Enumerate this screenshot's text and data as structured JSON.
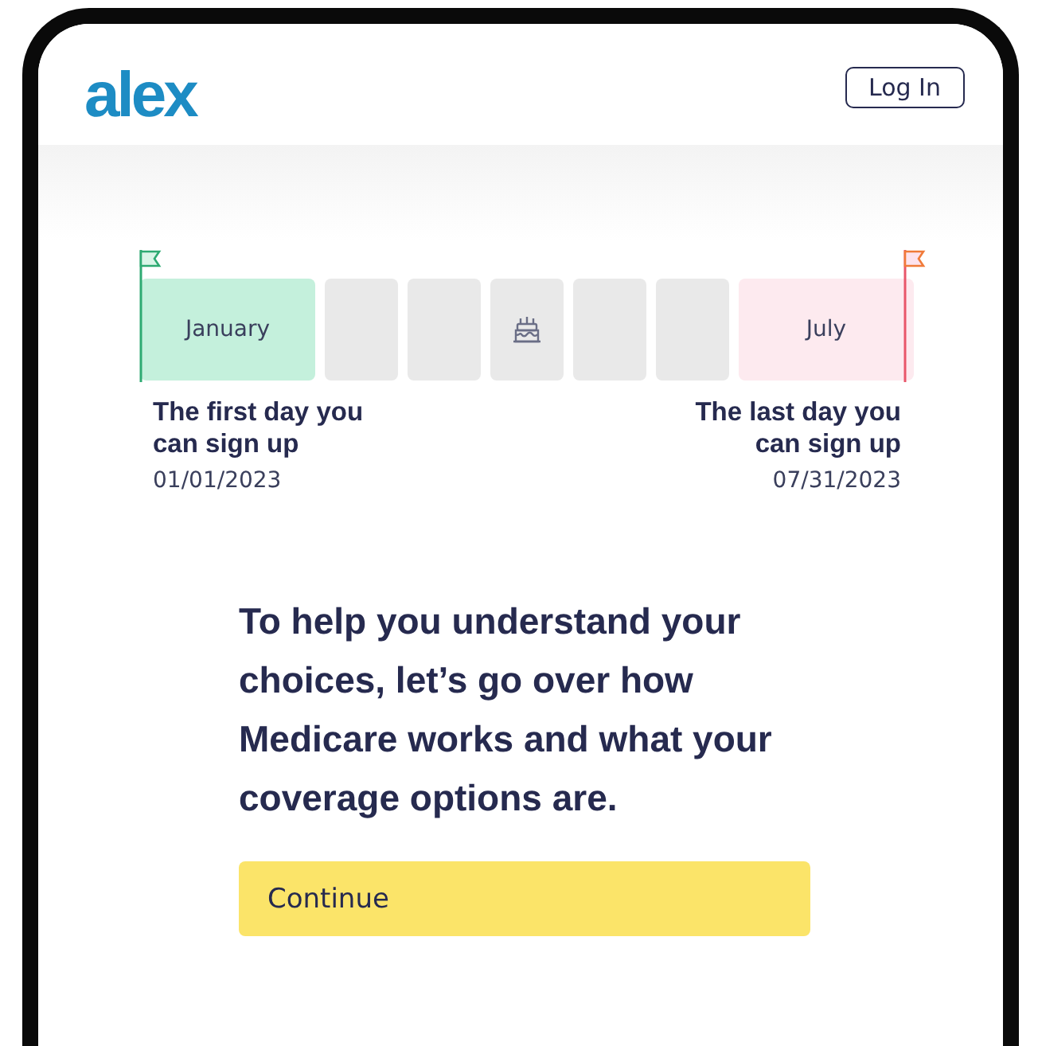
{
  "header": {
    "logo": "alex",
    "login_button": "Log In"
  },
  "timeline": {
    "months": [
      {
        "kind": "start",
        "label": "January"
      },
      {
        "kind": "blank"
      },
      {
        "kind": "blank"
      },
      {
        "kind": "birthday"
      },
      {
        "kind": "blank"
      },
      {
        "kind": "blank"
      },
      {
        "kind": "end",
        "label": "July"
      }
    ],
    "start_marker": {
      "title": "The first day you can sign up",
      "date": "01/01/2023"
    },
    "end_marker": {
      "title": "The last day you can sign up",
      "date": "07/31/2023"
    }
  },
  "message": "To help you understand your choices, let’s go over how Medicare works and what your coverage options are.",
  "continue_button": "Continue"
}
